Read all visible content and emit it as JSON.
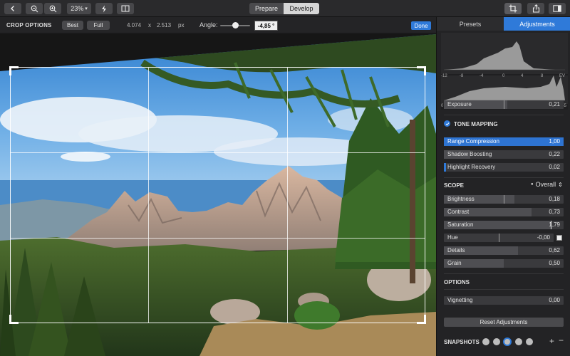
{
  "toolbar": {
    "zoom": "23%",
    "zoom_caret": "▾",
    "mode_prepare": "Prepare",
    "mode_develop": "Develop"
  },
  "crop": {
    "title": "CROP OPTIONS",
    "best": "Best",
    "full": "Full",
    "width": "4.074",
    "by": "x",
    "height": "2.513",
    "unit": "px",
    "angle_label": "Angle:",
    "angle_value": "-4,85 °",
    "done": "Done"
  },
  "panel": {
    "tab_presets": "Presets",
    "tab_adjustments": "Adjustments",
    "histogram_ev_ticks": [
      "-12",
      "-8",
      "-4",
      "0",
      "4",
      "8",
      "EV"
    ],
    "histogram_tone_ticks": [
      "0",
      "255"
    ],
    "exposure": {
      "label": "Exposure",
      "value": "0,21",
      "fraction": 0.53
    },
    "tone_mapping_title": "TONE MAPPING",
    "tone_mapping": [
      {
        "label": "Range Compression",
        "value": "1,00",
        "fraction": 1.0
      },
      {
        "label": "Shadow Boosting",
        "value": "0,22",
        "fraction": 0.22
      },
      {
        "label": "Highlight Recovery",
        "value": "0,02",
        "fraction": 0.02
      }
    ],
    "scope_title": "SCOPE",
    "scope_value": "Overall",
    "scope_bullet": "●",
    "scope_arrows": "⇕",
    "scope_rows": [
      {
        "label": "Brightness",
        "value": "0,18",
        "fraction": 0.59
      },
      {
        "label": "Contrast",
        "value": "0,73",
        "fraction": 0.73
      },
      {
        "label": "Saturation",
        "value": "1,79",
        "fraction": 0.9
      },
      {
        "label": "Hue",
        "value": "-0,00",
        "fraction": 0.5
      },
      {
        "label": "Details",
        "value": "0,62",
        "fraction": 0.62
      },
      {
        "label": "Grain",
        "value": "0,50",
        "fraction": 0.5
      }
    ],
    "options_title": "OPTIONS",
    "vignetting": {
      "label": "Vignetting",
      "value": "0,00",
      "fraction": 0.0
    },
    "reset": "Reset Adjustments",
    "snapshots_title": "SNAPSHOTS",
    "snapshot_add": "+",
    "snapshot_remove": "−"
  },
  "colors": {
    "accent": "#2f7ad9",
    "sky": "#3f8fd6",
    "forest": "#3a5a22"
  },
  "icons": [
    "back-icon",
    "zoom-out-icon",
    "zoom-in-icon",
    "lightning-icon",
    "compare-icon",
    "crop-icon",
    "share-icon",
    "sidebar-icon",
    "check-icon"
  ]
}
